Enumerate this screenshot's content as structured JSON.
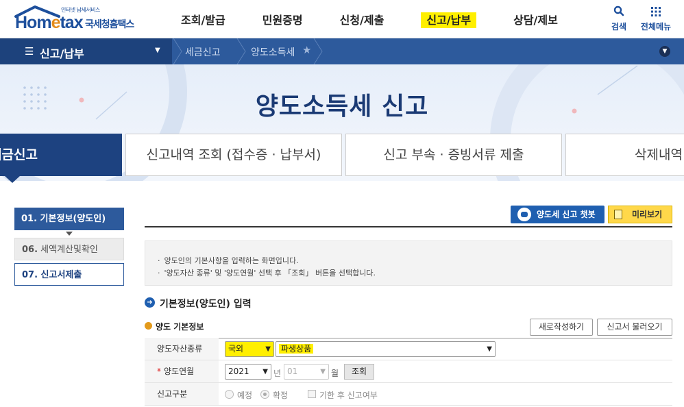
{
  "header": {
    "logo_sub": "인터넷 납세서비스",
    "logo_brand_a": "Hom",
    "logo_brand_e": "e",
    "logo_brand_b": "tax",
    "logo_korean": "국세청홈택스",
    "gnb": [
      "조회/발급",
      "민원증명",
      "신청/제출",
      "신고/납부",
      "상담/제보"
    ],
    "gnb_active_index": 3,
    "search_label": "검색",
    "allmenu_label": "전체메뉴"
  },
  "navbar": {
    "menu_label": "신고/납부",
    "crumbs": [
      "세금신고",
      "양도소득세"
    ]
  },
  "hero": {
    "title": "양도소득세  신고"
  },
  "tabs": [
    "세금신고",
    "신고내역 조회 (접수증 · 납부서)",
    "신고 부속 · 증빙서류 제출",
    "삭제내역"
  ],
  "steps": {
    "s1": "01. 기본정보(양도인)",
    "s2_num": "06.",
    "s2_text": " 세액계산및확인",
    "s3": "07. 신고서제출"
  },
  "actions": {
    "chatbot": "양도세 신고 챗봇",
    "preview": "미리보기"
  },
  "info": [
    "양도인의 기본사항을 입력하는 화면입니다.",
    "'양도자산 종류' 및 '양도연월' 선택 후 「조회」 버튼을 선택합니다."
  ],
  "section": {
    "title": "기본정보(양도인) 입력",
    "subtitle": "양도 기본정보",
    "new_button": "새로작성하기",
    "load_button": "신고서 불러오기"
  },
  "form": {
    "asset_label": "양도자산종류",
    "asset_region": "국외",
    "asset_type": "파생상품",
    "date_label": "양도연월",
    "year": "2021",
    "year_unit": "년",
    "month": "01",
    "month_unit": "월",
    "query_button": "조회",
    "kind_label": "신고구분",
    "kind_opt1": "예정",
    "kind_opt2": "확정",
    "late_label": "기한 후 신고여부"
  },
  "colors": {
    "brand": "#1d4f9c",
    "nav": "#2d5a9c",
    "highlight": "#ffef00",
    "accent": "#e48b1a"
  }
}
